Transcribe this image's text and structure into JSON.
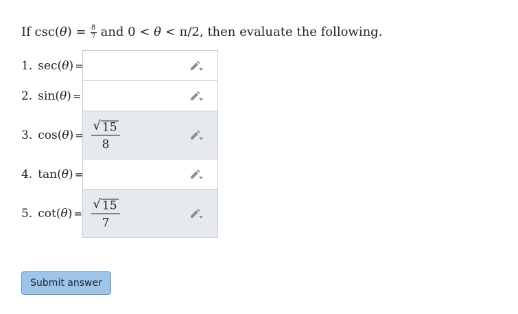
{
  "question": {
    "prefix": "If csc(",
    "theta": "θ",
    "mid": ") = ",
    "frac_num": "8",
    "frac_den": "7",
    "suffix_a": " and 0 < ",
    "suffix_theta": "θ",
    "suffix_b": " < π/2, then evaluate the following."
  },
  "items": [
    {
      "num": "1.",
      "fn": "sec(",
      "theta": "θ",
      "close": ")",
      "eq": "=",
      "value": ""
    },
    {
      "num": "2.",
      "fn": "sin(",
      "theta": "θ",
      "close": ")",
      "eq": "=",
      "value": ""
    },
    {
      "num": "3.",
      "fn": "cos(",
      "theta": "θ",
      "close": ")",
      "eq": "=",
      "value_sqrt": "15",
      "value_den": "8"
    },
    {
      "num": "4.",
      "fn": "tan(",
      "theta": "θ",
      "close": ")",
      "eq": "=",
      "value": ""
    },
    {
      "num": "5.",
      "fn": "cot(",
      "theta": "θ",
      "close": ")",
      "eq": "=",
      "value_sqrt": "15",
      "value_den": "7"
    }
  ],
  "icons": {
    "edit": "pencil-icon"
  },
  "colors": {
    "button_bg": "#9ec5e8",
    "button_border": "#5f8fbf",
    "filled_box": "#e6e9ed"
  },
  "submit_label": "Submit answer"
}
